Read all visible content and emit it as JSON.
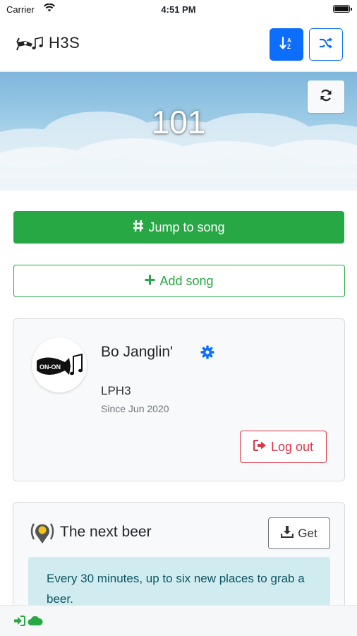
{
  "status_bar": {
    "carrier": "Carrier",
    "time": "4:51 PM"
  },
  "header": {
    "brand": "H3S",
    "icons": {
      "logo": "horn-music-logo",
      "sort": "sort-alpha-icon",
      "shuffle": "shuffle-icon"
    },
    "colors": {
      "primary": "#0d6efd"
    }
  },
  "hero": {
    "song_number": "101",
    "refresh_icon": "refresh-icon"
  },
  "actions": {
    "jump_label": "Jump to song",
    "jump_icon": "hashtag-icon",
    "add_label": "Add song",
    "add_icon": "plus-icon",
    "colors": {
      "success": "#28a745"
    }
  },
  "user_card": {
    "name": "Bo Janglin'",
    "kennel": "LPH3",
    "since": "Since Jun 2020",
    "logout_label": "Log out",
    "avatar_text": "ON-ON",
    "icons": {
      "settings": "gear-icon",
      "logout": "sign-out-icon"
    },
    "colors": {
      "danger": "#dc3545"
    }
  },
  "beer_card": {
    "title": "The next beer",
    "get_label": "Get",
    "info_text": "Every 30 minutes, up to six new places to grab a beer.",
    "icons": {
      "title": "map-pin-beer-icon",
      "get": "download-icon"
    }
  },
  "bottom_bar": {
    "icons": [
      "sign-in-icon",
      "cloud-icon"
    ]
  }
}
